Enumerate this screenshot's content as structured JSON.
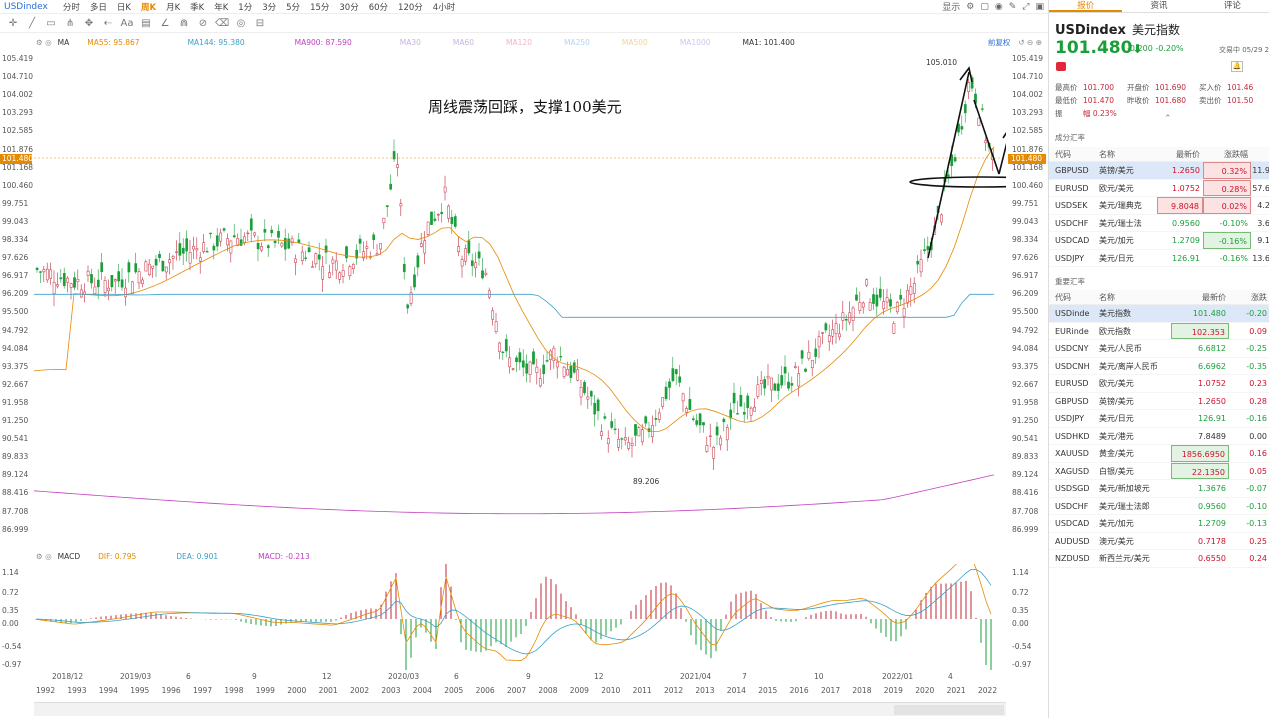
{
  "topbar": {
    "symbol": "USDindex",
    "timeframes": [
      "分时",
      "多日",
      "日K",
      "周K",
      "月K",
      "季K",
      "年K",
      "1分",
      "3分",
      "5分",
      "15分",
      "30分",
      "60分",
      "120分",
      "4小时"
    ],
    "active_timeframe": "周K",
    "display_label": "显示"
  },
  "indicators": {
    "ma_label": "MA",
    "ma55": "MA55: 95.867",
    "ma144": "MA144: 95.380",
    "ma900": "MA900: 87.590",
    "ma30": "MA30",
    "ma60": "MA60",
    "ma120": "MA120",
    "ma250": "MA250",
    "ma500": "MA500",
    "ma1000": "MA1000",
    "ma1": "MA1: 101.400",
    "adjust": "前复权",
    "colors": {
      "ma55": "#e58a00",
      "ma144": "#3aa0c8",
      "ma900": "#c040c0",
      "ma1": "#333333"
    }
  },
  "annotation": {
    "note": "周线震荡回踩，支撑100美元",
    "high_label": "105.010",
    "low_label": "89.206"
  },
  "price_axis": [
    "105.419",
    "104.710",
    "104.002",
    "103.293",
    "102.585",
    "101.876",
    "101.168",
    "100.460",
    "99.751",
    "99.043",
    "98.334",
    "97.626",
    "96.917",
    "96.209",
    "95.500",
    "94.792",
    "94.084",
    "93.375",
    "92.667",
    "91.958",
    "91.250",
    "90.541",
    "89.833",
    "89.124",
    "88.416",
    "87.708",
    "86.999"
  ],
  "current_price_tag": "101.480",
  "macd": {
    "label": "MACD",
    "dif": "DIF: 0.795",
    "dea": "DEA: 0.901",
    "macd": "MACD: -0.213",
    "axis": [
      "1.14",
      "0.72",
      "0.35",
      "0.00",
      "-0.54",
      "-0.97"
    ]
  },
  "x_axis_top": [
    "2018/12",
    "2019/03",
    "6",
    "9",
    "12",
    "2020/03",
    "6",
    "9",
    "12",
    "2021/04",
    "7",
    "10",
    "2022/01",
    "4"
  ],
  "x_axis_years": [
    "1992",
    "1993",
    "1994",
    "1995",
    "1996",
    "1997",
    "1998",
    "1999",
    "2000",
    "2001",
    "2002",
    "2003",
    "2004",
    "2005",
    "2006",
    "2007",
    "2008",
    "2009",
    "2010",
    "2011",
    "2012",
    "2013",
    "2014",
    "2015",
    "2016",
    "2017",
    "2018",
    "2019",
    "2020",
    "2021",
    "2022"
  ],
  "panel": {
    "tabs": [
      "报价",
      "资讯",
      "评论"
    ],
    "active_tab": "报价",
    "symbol": "USDindex",
    "name_cn": "美元指数",
    "price": "101.480",
    "change": "-0.200 -0.20%",
    "time": "交易中 05/29 21:52",
    "quotes": [
      {
        "l1": "最高价",
        "v1": "101.700",
        "l2": "开盘价",
        "v2": "101.690",
        "l3": "买入价",
        "v3": "101.46"
      },
      {
        "l1": "最低价",
        "v1": "101.470",
        "l2": "昨收价",
        "v2": "101.680",
        "l3": "卖出价",
        "v3": "101.50"
      },
      {
        "l1": "振",
        "v1": "幅 0.23%",
        "l2": "",
        "v2": "",
        "l3": "",
        "v3": ""
      }
    ],
    "components_title": "成分汇率",
    "components_header": [
      "代码",
      "名称",
      "最新价",
      "涨跌幅",
      ""
    ],
    "components": [
      {
        "code": "GBPUSD",
        "name": "英镑/美元",
        "price": "1.2650",
        "pct": "0.32%",
        "extra": "11.9",
        "dir": "up",
        "sel": true
      },
      {
        "code": "EURUSD",
        "name": "欧元/美元",
        "price": "1.0752",
        "pct": "0.28%",
        "extra": "57.6",
        "dir": "up",
        "sel": false
      },
      {
        "code": "USDSEK",
        "name": "美元/瑞典克",
        "price": "9.8048",
        "pct": "0.02%",
        "extra": "4.2",
        "dir": "up",
        "sel": false
      },
      {
        "code": "USDCHF",
        "name": "美元/瑞士法",
        "price": "0.9560",
        "pct": "-0.10%",
        "extra": "3.6",
        "dir": "dn",
        "sel": false
      },
      {
        "code": "USDCAD",
        "name": "美元/加元",
        "price": "1.2709",
        "pct": "-0.16%",
        "extra": "9.1",
        "dir": "dn",
        "sel": false
      },
      {
        "code": "USDJPY",
        "name": "美元/日元",
        "price": "126.91",
        "pct": "-0.16%",
        "extra": "13.6",
        "dir": "dn",
        "sel": false
      }
    ],
    "major_title": "重要汇率",
    "major_header": [
      "代码",
      "名称",
      "最新价",
      "涨跌"
    ],
    "major": [
      {
        "code": "USDinde",
        "name": "美元指数",
        "price": "101.480",
        "chg": "-0.20",
        "dir": "dn",
        "sel": true
      },
      {
        "code": "EURinde",
        "name": "欧元指数",
        "price": "102.353",
        "chg": "0.09",
        "dir": "up",
        "sel": false
      },
      {
        "code": "USDCNY",
        "name": "美元/人民币",
        "price": "6.6812",
        "chg": "-0.25",
        "dir": "dn",
        "sel": false
      },
      {
        "code": "USDCNH",
        "name": "美元/离岸人民币",
        "price": "6.6962",
        "chg": "-0.35",
        "dir": "dn",
        "sel": false
      },
      {
        "code": "EURUSD",
        "name": "欧元/美元",
        "price": "1.0752",
        "chg": "0.23",
        "dir": "up",
        "sel": false
      },
      {
        "code": "GBPUSD",
        "name": "英镑/美元",
        "price": "1.2650",
        "chg": "0.28",
        "dir": "up",
        "sel": false
      },
      {
        "code": "USDJPY",
        "name": "美元/日元",
        "price": "126.91",
        "chg": "-0.16",
        "dir": "dn",
        "sel": false
      },
      {
        "code": "USDHKD",
        "name": "美元/港元",
        "price": "7.8489",
        "chg": "0.00",
        "dir": "flat",
        "sel": false
      },
      {
        "code": "XAUUSD",
        "name": "黄金/美元",
        "price": "1856.6950",
        "chg": "0.16",
        "dir": "up",
        "sel": false
      },
      {
        "code": "XAGUSD",
        "name": "白银/美元",
        "price": "22.1350",
        "chg": "0.05",
        "dir": "up",
        "sel": false
      },
      {
        "code": "USDSGD",
        "name": "美元/新加坡元",
        "price": "1.3676",
        "chg": "-0.07",
        "dir": "dn",
        "sel": false
      },
      {
        "code": "USDCHF",
        "name": "美元/瑞士法郎",
        "price": "0.9560",
        "chg": "-0.10",
        "dir": "dn",
        "sel": false
      },
      {
        "code": "USDCAD",
        "name": "美元/加元",
        "price": "1.2709",
        "chg": "-0.13",
        "dir": "dn",
        "sel": false
      },
      {
        "code": "AUDUSD",
        "name": "澳元/美元",
        "price": "0.7178",
        "chg": "0.25",
        "dir": "up",
        "sel": false
      },
      {
        "code": "NZDUSD",
        "name": "新西兰元/美元",
        "price": "0.6550",
        "chg": "0.24",
        "dir": "up",
        "sel": false
      }
    ]
  }
}
